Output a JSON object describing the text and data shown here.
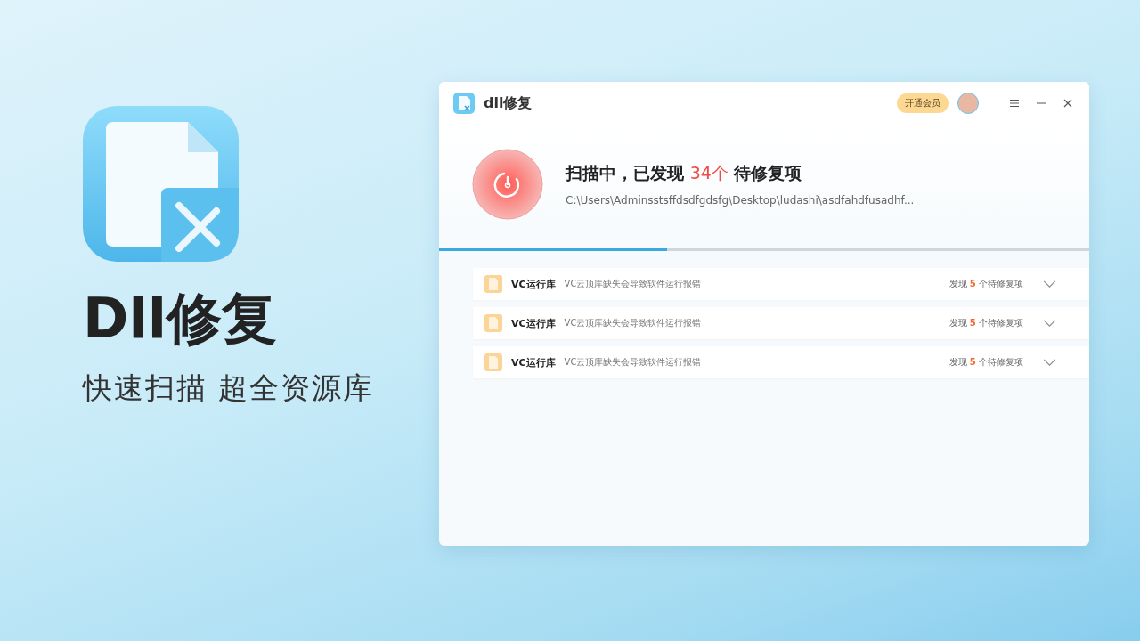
{
  "promo": {
    "title": "Dll修复",
    "tagline": "快速扫描 超全资源库"
  },
  "window": {
    "title": "dll修复",
    "vip_button": "开通会员"
  },
  "scan": {
    "status_before": "扫描中，已发现",
    "count": "34个",
    "status_after": "待修复项",
    "path": "C:\\Users\\Adminsstsffdsdfgdsfg\\Desktop\\ludashi\\asdfahdfusadhf...",
    "level": 0.35
  },
  "results": [
    {
      "name": "VC运行库",
      "description": "VC云顶库缺失会导致软件运行报错",
      "found_before": "发现",
      "found_count": "5",
      "found_after": "个待修复项"
    },
    {
      "name": "VC运行库",
      "description": "VC云顶库缺失会导致软件运行报错",
      "found_before": "发现",
      "found_count": "5",
      "found_after": "个待修复项"
    },
    {
      "name": "VC运行库",
      "description": "VC云顶库缺失会导致软件运行报错",
      "found_before": "发现",
      "found_count": "5",
      "found_after": "个待修复项"
    }
  ]
}
